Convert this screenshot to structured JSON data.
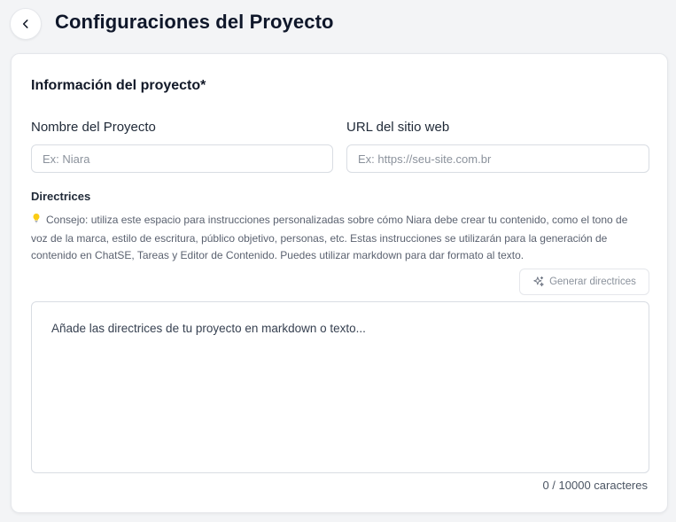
{
  "header": {
    "back_icon": "chevron-left-icon",
    "title": "Configuraciones del Proyecto"
  },
  "project_info": {
    "section_title": "Información del proyecto*",
    "name_field": {
      "label": "Nombre del Proyecto",
      "placeholder": "Ex: Niara",
      "value": ""
    },
    "url_field": {
      "label": "URL del sitio web",
      "placeholder": "Ex: https://seu-site.com.br",
      "value": ""
    },
    "guidelines": {
      "label": "Directrices",
      "tip_icon": "lightbulb-icon",
      "tip": "Consejo: utiliza este espacio para instrucciones personalizadas sobre cómo Niara debe crear tu contenido, como el tono de voz de la marca, estilo de escritura, público objetivo, personas, etc. Estas instrucciones se utilizarán para la generación de contenido en ChatSE, Tareas y Editor de Contenido. Puedes utilizar markdown para dar formato al texto.",
      "generate_button": {
        "icon": "sparkles-icon",
        "label": "Generar directrices"
      },
      "placeholder": "Añade las directrices de tu proyecto en markdown o texto...",
      "value": "",
      "counter": "0 / 10000 caracteres"
    }
  }
}
